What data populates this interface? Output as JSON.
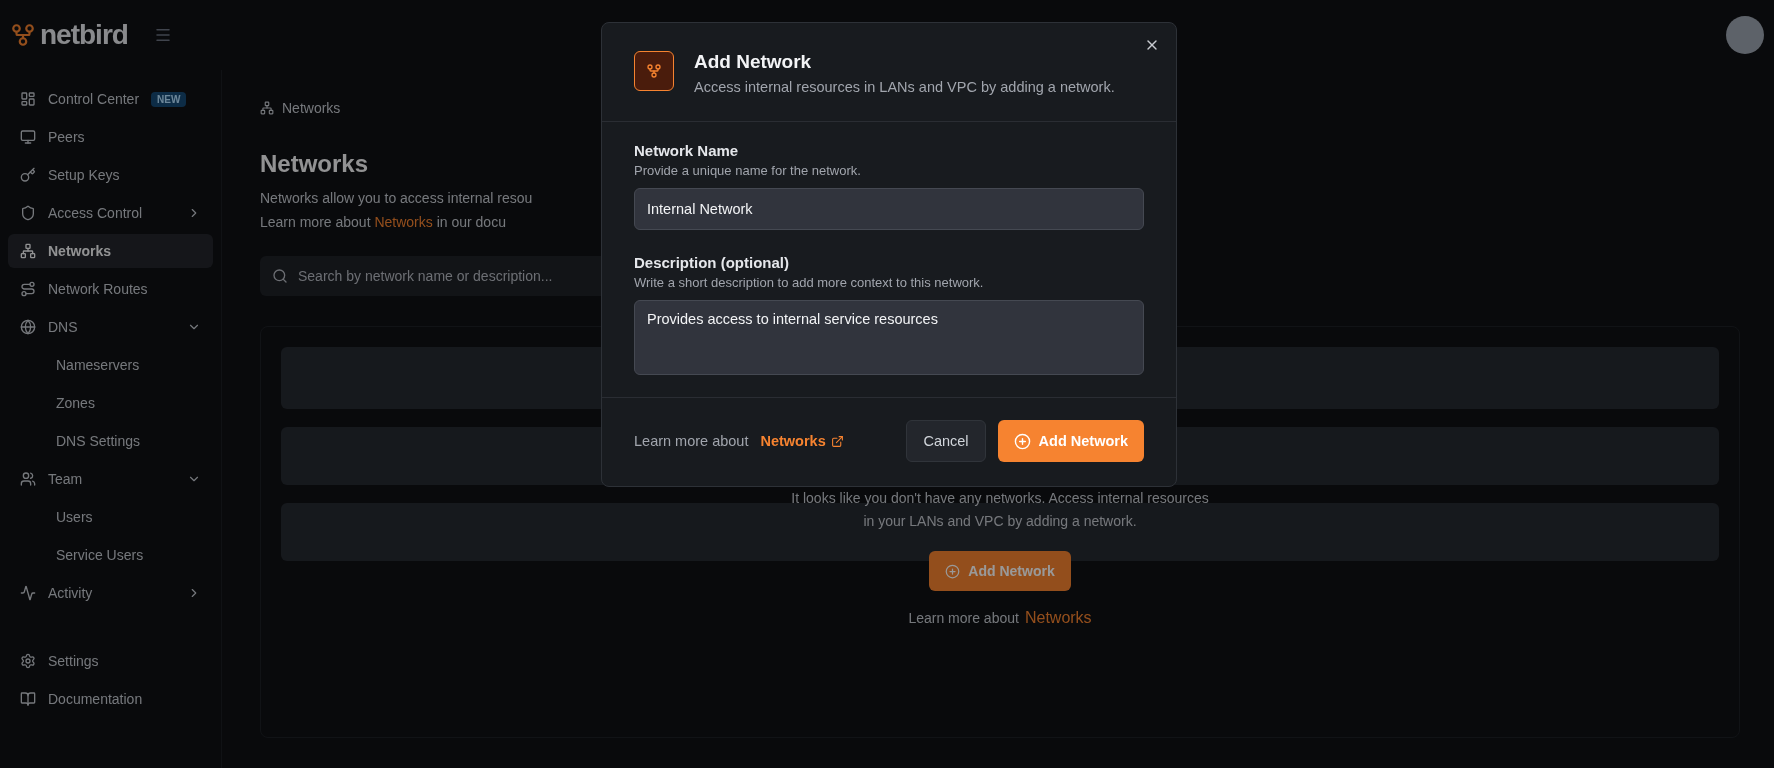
{
  "logo": "netbird",
  "sidebar": {
    "items": [
      {
        "label": "Control Center",
        "badge": "NEW",
        "selected": false
      },
      {
        "label": "Peers",
        "selected": false
      },
      {
        "label": "Setup Keys",
        "selected": false
      },
      {
        "label": "Access Control",
        "selected": false,
        "expanded": false
      },
      {
        "label": "Networks",
        "selected": true
      },
      {
        "label": "Network Routes",
        "selected": false
      },
      {
        "label": "DNS",
        "selected": false,
        "expanded": true,
        "children": [
          {
            "label": "Nameservers",
            "selected": false
          },
          {
            "label": "Zones",
            "selected": false
          },
          {
            "label": "DNS Settings",
            "selected": false
          }
        ]
      },
      {
        "label": "Team",
        "selected": false,
        "expanded": true,
        "children": [
          {
            "label": "Users",
            "selected": false
          },
          {
            "label": "Service Users",
            "selected": false
          }
        ]
      },
      {
        "label": "Activity",
        "selected": false,
        "expanded": false
      }
    ],
    "bottom_items": [
      {
        "label": "Settings",
        "selected": false
      },
      {
        "label": "Documentation",
        "selected": false
      }
    ]
  },
  "breadcrumb": "Networks",
  "page": {
    "title": "Networks",
    "description": "Networks allow you to access internal resou",
    "learn_more": "Learn more about",
    "learn_more_link": "Networks",
    "learn_more_rest": "in our docu"
  },
  "search": {
    "placeholder": "Search by network name or description..."
  },
  "empty_state": {
    "text": "It looks like you don't have any networks. Access internal resources in your LANs and VPC by adding a network.",
    "button": "Add Network",
    "learn_more": "Learn more about",
    "link": "Networks"
  },
  "modal": {
    "title": "Add Network",
    "subtitle": "Access internal resources in LANs and VPC by adding a network.",
    "fields": [
      {
        "kind": "input",
        "label": "Network Name",
        "hint": "Provide a unique name for the network.",
        "value": "Internal Network"
      },
      {
        "kind": "textarea",
        "label": "Description (optional)",
        "hint": "Write a short description to add more context to this network.",
        "value": "Provides access to internal service resources"
      }
    ],
    "learn_more": "Learn more about",
    "link": "Networks",
    "cancel": "Cancel",
    "submit": "Add Network"
  }
}
